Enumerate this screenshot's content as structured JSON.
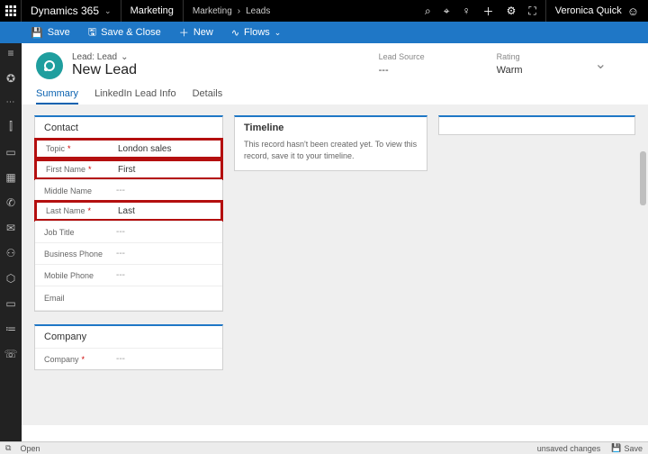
{
  "topbar": {
    "product": "Dynamics 365",
    "app": "Marketing",
    "crumb1": "Marketing",
    "crumb2": "Leads",
    "user": "Veronica Quick"
  },
  "cmdbar": {
    "save": "Save",
    "saveclose": "Save & Close",
    "newlabel": "New",
    "flows": "Flows"
  },
  "header": {
    "kind": "Lead: Lead",
    "title": "New Lead",
    "leadsource_label": "Lead Source",
    "leadsource_value": "---",
    "rating_label": "Rating",
    "rating_value": "Warm"
  },
  "tabs": {
    "summary": "Summary",
    "linkedin": "LinkedIn Lead Info",
    "details": "Details"
  },
  "contact": {
    "title": "Contact",
    "topic_label": "Topic",
    "topic_value": "London sales",
    "first_label": "First Name",
    "first_value": "First",
    "middle_label": "Middle Name",
    "middle_value": "---",
    "last_label": "Last Name",
    "last_value": "Last",
    "job_label": "Job Title",
    "job_value": "---",
    "bphone_label": "Business Phone",
    "bphone_value": "---",
    "mphone_label": "Mobile Phone",
    "mphone_value": "---",
    "email_label": "Email",
    "email_value": ""
  },
  "company": {
    "title": "Company",
    "company_label": "Company",
    "company_value": "---"
  },
  "timeline": {
    "title": "Timeline",
    "body": "This record hasn't been created yet. To view this record, save it to your timeline."
  },
  "statusbar": {
    "open": "Open",
    "unsaved": "unsaved changes",
    "save_label": "Save"
  }
}
